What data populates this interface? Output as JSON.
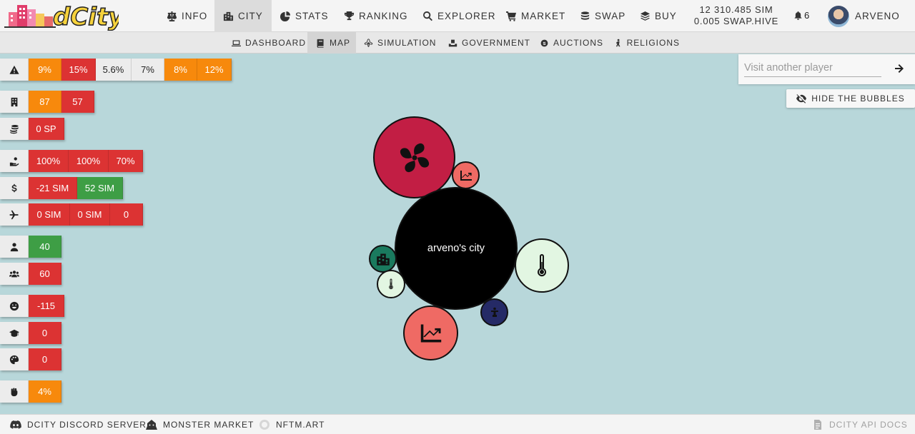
{
  "app": {
    "name": "dCity"
  },
  "topnav": {
    "items": [
      {
        "label": "INFO",
        "icon": "scale-icon"
      },
      {
        "label": "CITY",
        "icon": "city-icon"
      },
      {
        "label": "STATS",
        "icon": "pie-chart-icon"
      },
      {
        "label": "RANKING",
        "icon": "trophy-icon"
      },
      {
        "label": "EXPLORER",
        "icon": "search-icon"
      },
      {
        "label": "MARKET",
        "icon": "cart-icon"
      },
      {
        "label": "SWAP",
        "icon": "coins-icon"
      },
      {
        "label": "BUY",
        "icon": "layers-icon"
      }
    ],
    "active": "CITY",
    "balance_sim": "12 310.485 SIM",
    "balance_swap": "0.005 SWAP.HIVE",
    "notifications": "6",
    "username": "ARVENO"
  },
  "subnav": {
    "items": [
      {
        "label": "DASHBOARD",
        "icon": "laptop-icon"
      },
      {
        "label": "MAP",
        "icon": "book-icon"
      },
      {
        "label": "SIMULATION",
        "icon": "atom-icon"
      },
      {
        "label": "GOVERNMENT",
        "icon": "vote-icon"
      },
      {
        "label": "AUCTIONS",
        "icon": "auction-icon"
      },
      {
        "label": "RELIGIONS",
        "icon": "pray-icon"
      }
    ],
    "active": "MAP"
  },
  "stats": {
    "risks": [
      "9%",
      "15%",
      "5.6%",
      "7%",
      "8%",
      "12%"
    ],
    "buildings": [
      "87",
      "57"
    ],
    "sp": [
      "0 SP"
    ],
    "income_rates": [
      "100%",
      "100%",
      "70%"
    ],
    "money": [
      "-21 SIM",
      "52 SIM"
    ],
    "tourism": [
      "0 SIM",
      "0 SIM",
      "0"
    ],
    "population": [
      "40"
    ],
    "workers": [
      "60"
    ],
    "happiness": [
      "-115"
    ],
    "education": [
      "0"
    ],
    "culture": [
      "0"
    ],
    "revolt": [
      "4%"
    ]
  },
  "colors": {
    "orange": "#f7890c",
    "red": "#dc3333",
    "green": "#3e9e45",
    "grey": "#ececec",
    "map_bg": "#b8d7da"
  },
  "visit": {
    "placeholder": "Visit another player"
  },
  "hide_bubbles": {
    "label": "HIDE THE BUBBLES"
  },
  "city": {
    "label": "arveno's city"
  },
  "footer": {
    "discord": "DCITY DISCORD SERVER",
    "monster": "MONSTER MARKET",
    "nftm": "NFTM.ART",
    "api": "DCITY API DOCS"
  }
}
